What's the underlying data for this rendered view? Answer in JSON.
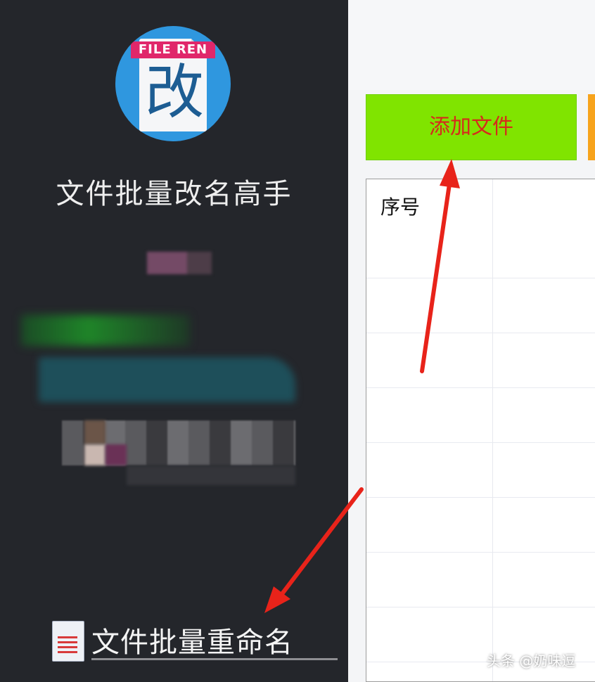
{
  "sidebar": {
    "logo_tag": "FILE REN",
    "logo_glyph": "改",
    "app_name": "文件批量改名高手",
    "menu": {
      "batch_rename_label": "文件批量重命名"
    }
  },
  "main": {
    "add_file_label": "添加文件",
    "table": {
      "col_index": "序号"
    }
  },
  "watermark": "头条 @奶味逗",
  "colors": {
    "sidebar_bg": "#24262b",
    "add_button": "#80e400",
    "add_button_text": "#d62a1c",
    "arrow": "#e8231a",
    "logo_blue": "#2f97df"
  }
}
